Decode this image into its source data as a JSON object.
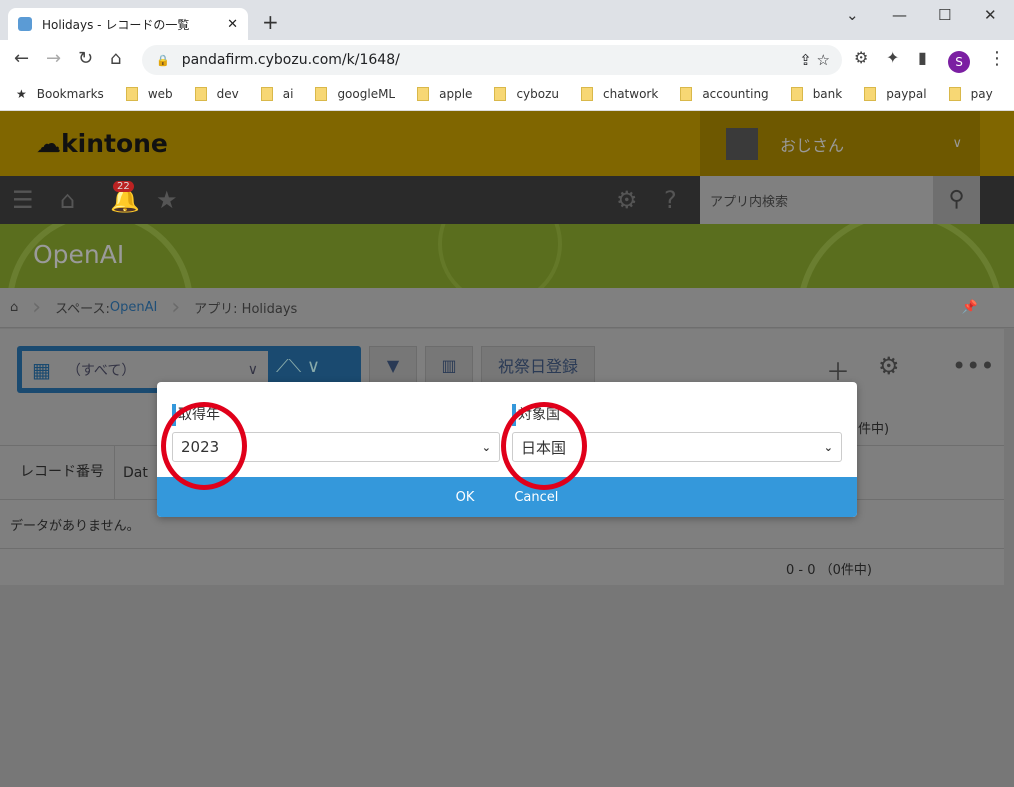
{
  "browser": {
    "tab_title": "Holidays - レコードの一覧",
    "url": "pandafirm.cybozu.com/k/1648/",
    "profile_initial": "S",
    "bookmarks": [
      "Bookmarks",
      "web",
      "dev",
      "ai",
      "googleML",
      "apple",
      "cybozu",
      "chatwork",
      "accounting",
      "bank",
      "paypal",
      "pay"
    ]
  },
  "header": {
    "logo": "kintone",
    "user": "おじさん",
    "notification_count": "22",
    "search_placeholder": "アプリ内検索"
  },
  "space": {
    "title": "OpenAI"
  },
  "breadcrumb": {
    "space_prefix": "スペース: ",
    "space_link": "OpenAI",
    "app": "アプリ: Holidays"
  },
  "toolbar": {
    "view": "（すべて）",
    "custom_button": "祝祭日登録"
  },
  "table": {
    "columns": [
      "レコード番号",
      "Dat"
    ],
    "empty": "データがありません。",
    "pager": "0 - 0 （0件中)",
    "pager_partial": "件中)"
  },
  "dialog": {
    "year_label": "取得年",
    "year_value": "2023",
    "country_label": "対象国",
    "country_value": "日本国",
    "ok": "OK",
    "cancel": "Cancel"
  },
  "colors": {
    "dialog_accent": "#3498db",
    "annotation_circle": "#e0001a"
  }
}
